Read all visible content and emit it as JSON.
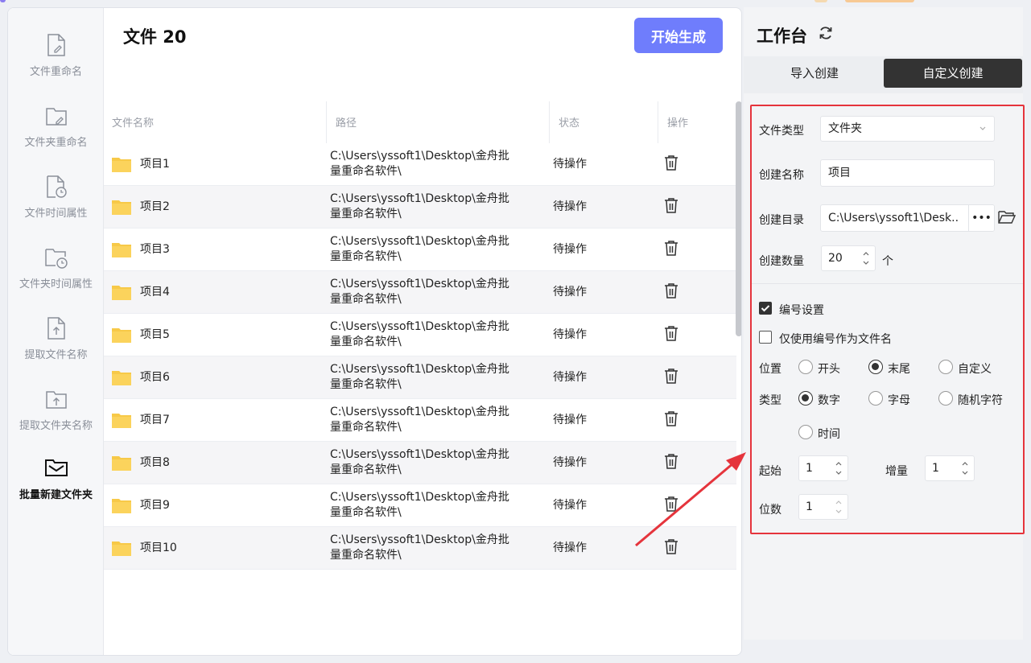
{
  "sidebar": {
    "items": [
      {
        "label": "文件重命名",
        "icon": "file-edit-icon"
      },
      {
        "label": "文件夹重命名",
        "icon": "folder-edit-icon"
      },
      {
        "label": "文件时间属性",
        "icon": "file-clock-icon"
      },
      {
        "label": "文件夹时间属性",
        "icon": "folder-clock-icon"
      },
      {
        "label": "提取文件名称",
        "icon": "file-upload-icon"
      },
      {
        "label": "提取文件夹名称",
        "icon": "folder-upload-icon"
      },
      {
        "label": "批量新建文件夹",
        "icon": "new-folder-icon",
        "active": true
      }
    ]
  },
  "header": {
    "title": "文件 20",
    "start_button": "开始生成"
  },
  "table": {
    "columns": [
      "文件名称",
      "路径",
      "状态",
      "操作"
    ],
    "rows": [
      {
        "name": "项目1",
        "path_line1": "C:\\Users\\yssoft1\\Desktop\\金舟批",
        "path_line2": "量重命名软件\\",
        "status": "待操作"
      },
      {
        "name": "项目2",
        "path_line1": "C:\\Users\\yssoft1\\Desktop\\金舟批",
        "path_line2": "量重命名软件\\",
        "status": "待操作"
      },
      {
        "name": "项目3",
        "path_line1": "C:\\Users\\yssoft1\\Desktop\\金舟批",
        "path_line2": "量重命名软件\\",
        "status": "待操作"
      },
      {
        "name": "项目4",
        "path_line1": "C:\\Users\\yssoft1\\Desktop\\金舟批",
        "path_line2": "量重命名软件\\",
        "status": "待操作"
      },
      {
        "name": "项目5",
        "path_line1": "C:\\Users\\yssoft1\\Desktop\\金舟批",
        "path_line2": "量重命名软件\\",
        "status": "待操作"
      },
      {
        "name": "项目6",
        "path_line1": "C:\\Users\\yssoft1\\Desktop\\金舟批",
        "path_line2": "量重命名软件\\",
        "status": "待操作"
      },
      {
        "name": "项目7",
        "path_line1": "C:\\Users\\yssoft1\\Desktop\\金舟批",
        "path_line2": "量重命名软件\\",
        "status": "待操作"
      },
      {
        "name": "项目8",
        "path_line1": "C:\\Users\\yssoft1\\Desktop\\金舟批",
        "path_line2": "量重命名软件\\",
        "status": "待操作"
      },
      {
        "name": "项目9",
        "path_line1": "C:\\Users\\yssoft1\\Desktop\\金舟批",
        "path_line2": "量重命名软件\\",
        "status": "待操作"
      },
      {
        "name": "项目10",
        "path_line1": "C:\\Users\\yssoft1\\Desktop\\金舟批",
        "path_line2": "量重命名软件\\",
        "status": "待操作"
      }
    ]
  },
  "workbench": {
    "title": "工作台",
    "tabs": [
      "导入创建",
      "自定义创建"
    ],
    "active_tab": "自定义创建",
    "file_type_label": "文件类型",
    "file_type_value": "文件夹",
    "name_label": "创建名称",
    "name_value": "项目",
    "dir_label": "创建目录",
    "dir_value": "C:\\Users\\yssoft1\\Desk..",
    "dir_more": "•••",
    "count_label": "创建数量",
    "count_value": "20",
    "count_unit": "个",
    "numbering_label": "编号设置",
    "numbering_checked": true,
    "only_number_label": "仅使用编号作为文件名",
    "only_number_checked": false,
    "position_label": "位置",
    "position_options": [
      "开头",
      "末尾",
      "自定义"
    ],
    "position_selected": "末尾",
    "type_label": "类型",
    "type_options": [
      "数字",
      "字母",
      "随机字符",
      "时间"
    ],
    "type_selected": "数字",
    "start_label": "起始",
    "start_value": "1",
    "step_label": "增量",
    "step_value": "1",
    "digits_label": "位数",
    "digits_value": "1"
  },
  "colors": {
    "accent": "#6f7dfc",
    "highlight_border": "#e5343c",
    "folder": "#f7c948",
    "dark_tab": "#333333"
  }
}
